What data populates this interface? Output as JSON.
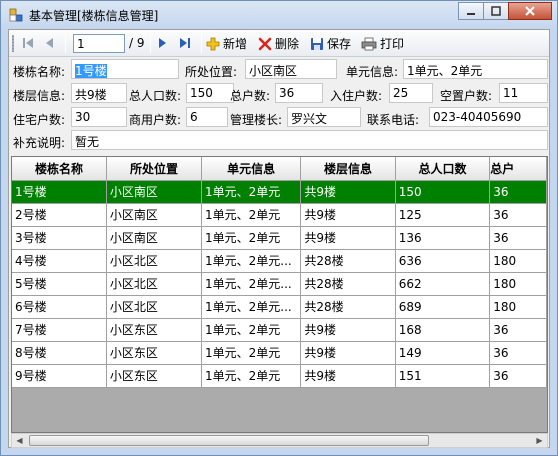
{
  "window": {
    "title": "基本管理[楼栋信息管理]"
  },
  "toolbar": {
    "position": "1",
    "count": "/ 9",
    "add_label": "新增",
    "delete_label": "删除",
    "save_label": "保存",
    "print_label": "打印"
  },
  "form": {
    "building_name_label": "楼栋名称:",
    "building_name_value": "1号楼",
    "location_label": "所处位置:",
    "location_value": "小区南区",
    "unit_label": "单元信息:",
    "unit_value": "1单元、2单元",
    "floor_label": "楼层信息:",
    "floor_value": "共9楼",
    "population_label": "总人口数:",
    "population_value": "150",
    "households_label": "总户数:",
    "households_value": "36",
    "occupied_label": "入住户数:",
    "occupied_value": "25",
    "vacant_label": "空置户数:",
    "vacant_value": "11",
    "residential_label": "住宅户数:",
    "residential_value": "30",
    "commercial_label": "商用户数:",
    "commercial_value": "6",
    "manager_label": "管理楼长:",
    "manager_value": "罗兴文",
    "phone_label": "联系电话:",
    "phone_value": "023-40405690",
    "remark_label": "补充说明:",
    "remark_value": "暂无"
  },
  "grid": {
    "columns": [
      "楼栋名称",
      "所处位置",
      "单元信息",
      "楼层信息",
      "总人口数",
      "总户"
    ],
    "rows": [
      [
        "1号楼",
        "小区南区",
        "1单元、2单元",
        "共9楼",
        "150",
        "36"
      ],
      [
        "2号楼",
        "小区南区",
        "1单元、2单元",
        "共9楼",
        "125",
        "36"
      ],
      [
        "3号楼",
        "小区南区",
        "1单元、2单元",
        "共9楼",
        "136",
        "36"
      ],
      [
        "4号楼",
        "小区北区",
        "1单元、2单元...",
        "共28楼",
        "636",
        "180"
      ],
      [
        "5号楼",
        "小区北区",
        "1单元、2单元...",
        "共28楼",
        "662",
        "180"
      ],
      [
        "6号楼",
        "小区北区",
        "1单元、2单元...",
        "共28楼",
        "689",
        "180"
      ],
      [
        "7号楼",
        "小区东区",
        "1单元、2单元",
        "共9楼",
        "168",
        "36"
      ],
      [
        "8号楼",
        "小区东区",
        "1单元、2单元",
        "共9楼",
        "149",
        "36"
      ],
      [
        "9号楼",
        "小区东区",
        "1单元、2单元",
        "共9楼",
        "151",
        "36"
      ]
    ],
    "selected_row": 0
  },
  "colors": {
    "selected_row_bg": "#008000",
    "title_bg": "#c5d7ee"
  },
  "icons": [
    "app-icon",
    "first-icon",
    "prev-icon",
    "next-icon",
    "last-icon",
    "add-icon",
    "delete-icon",
    "save-icon",
    "print-icon"
  ]
}
